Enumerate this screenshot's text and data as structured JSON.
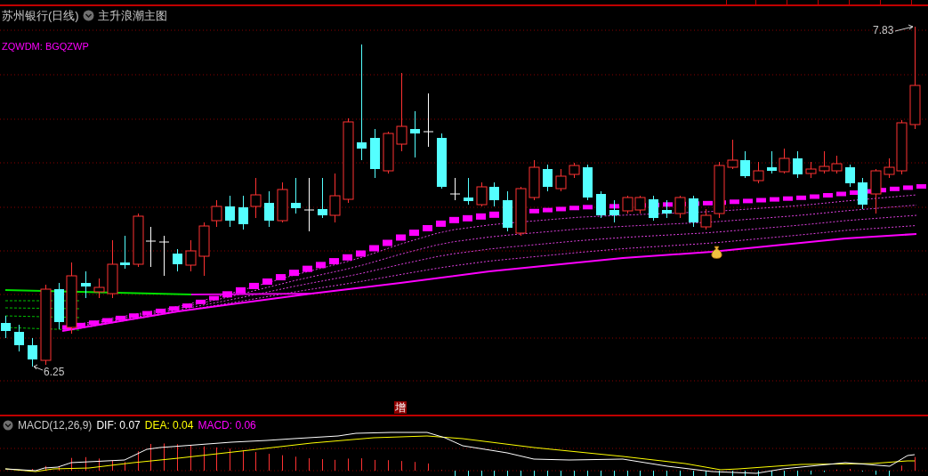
{
  "chart_header": {
    "title": "苏州银行(日线)",
    "indicator": "主升浪潮主图"
  },
  "formula_label": "ZQWDM: BGQZWP",
  "price_labels": {
    "high": "7.83",
    "low": "6.25"
  },
  "badge": "增",
  "macd_panel": {
    "name": "MACD(12,26,9)",
    "readings": [
      {
        "text": "DIF: 0.07",
        "color": "#ffffff"
      },
      {
        "text": "DEA: 0.04",
        "color": "#ffff00"
      },
      {
        "text": "MACD: 0.06",
        "color": "#ff00ff"
      }
    ]
  }
}
